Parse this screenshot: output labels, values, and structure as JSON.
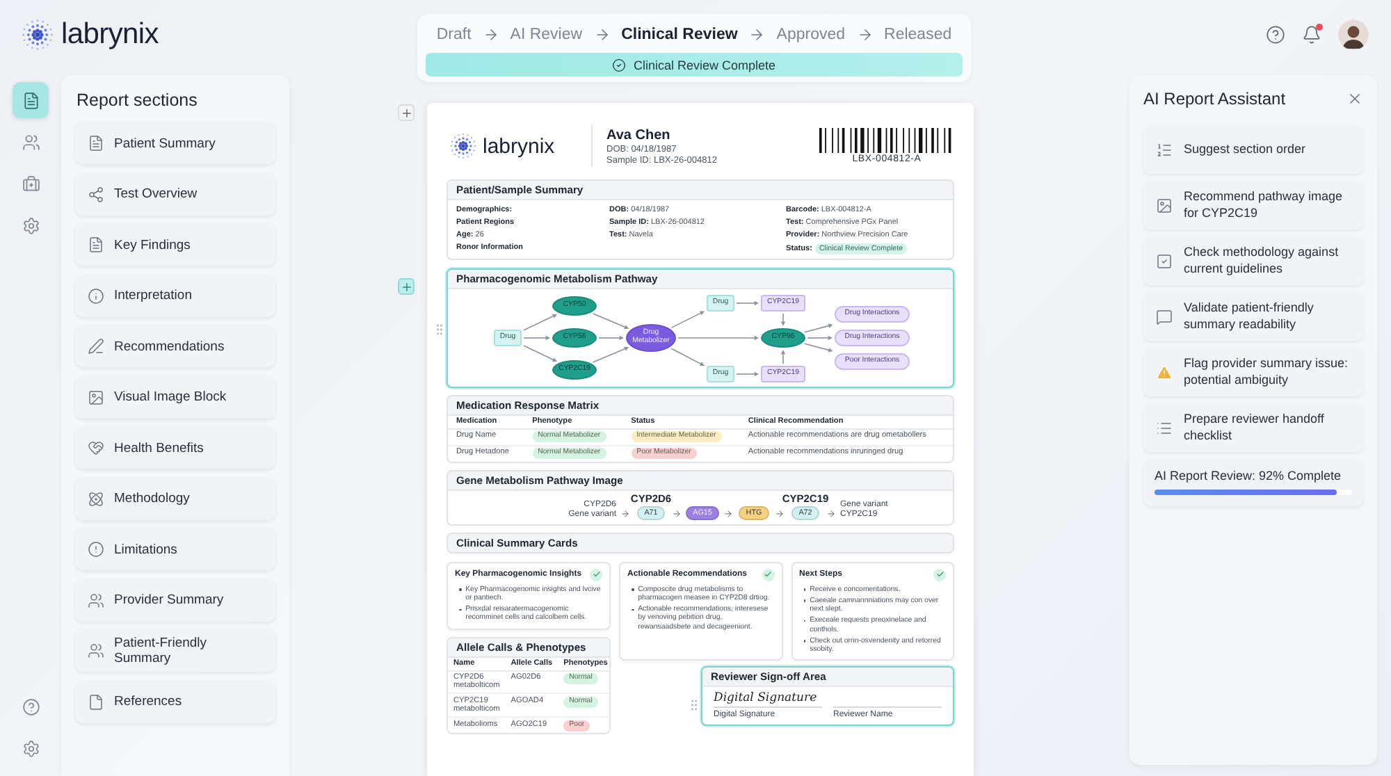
{
  "app": {
    "name": "labrynix"
  },
  "rail": [
    {
      "selected": true
    },
    {
      "selected": false
    },
    {
      "selected": false
    },
    {
      "selected": false
    }
  ],
  "workflow": {
    "steps": [
      {
        "label": "Draft",
        "selected": false
      },
      {
        "label": "AI Review",
        "selected": false
      },
      {
        "label": "Clinical Review",
        "selected": true
      },
      {
        "label": "Approved",
        "selected": false
      },
      {
        "label": "Released",
        "selected": false
      }
    ],
    "banner": "Clinical Review Complete"
  },
  "header": {
    "notifications_unread": true
  },
  "sections": {
    "title": "Report sections",
    "items": [
      "Patient Summary",
      "Test Overview",
      "Key Findings",
      "Interpretation",
      "Recommendations",
      "Visual Image Block",
      "Health Benefits",
      "Methodology",
      "Limitations",
      "Provider Summary",
      "Patient-Friendly Summary",
      "References"
    ]
  },
  "report": {
    "brand": "labrynix",
    "patient_name": "Ava Chen",
    "dob": "DOB: 04/18/1987",
    "sample_id": "Sample ID: LBX-26-004812",
    "barcode": "LBX-004812-A",
    "summary": {
      "title": "Patient/Sample Summary",
      "columns": [
        [
          {
            "label": "Demographics:"
          },
          {
            "label": "Patient Regions"
          },
          {
            "label": "Age:",
            "value": "26"
          },
          {
            "label": "Ronor Information"
          }
        ],
        [
          {
            "label": "DOB:",
            "value": "04/18/1987"
          },
          {
            "label": "Sample ID:",
            "value": "LBX-26-004812"
          },
          {
            "label": "Test:",
            "value": "Navela"
          }
        ],
        [
          {
            "label": "Barcode:",
            "value": "LBX-004812-A"
          },
          {
            "label": "Test:",
            "value": "Comprehensive PGx Panel"
          },
          {
            "label": "Provider:",
            "value": "Northview Precision Care"
          },
          {
            "label": "Status:",
            "badge": "Clinical Review Complete"
          }
        ]
      ]
    },
    "pathway": {
      "title": "Pharmacogenomic Metabolism Pathway",
      "selected": true,
      "nodes": [
        {
          "label": "Drug",
          "kind": "drug"
        },
        {
          "label": "CYP50",
          "kind": "enzyme"
        },
        {
          "label": "CYP56",
          "kind": "enzyme"
        },
        {
          "label": "CYP2C19",
          "kind": "enzyme"
        },
        {
          "label": "Drug Metabolizer",
          "kind": "metabolizer"
        },
        {
          "label": "Drug",
          "kind": "drug"
        },
        {
          "label": "CYP2C19",
          "kind": "target"
        },
        {
          "label": "CYP96",
          "kind": "enzyme"
        },
        {
          "label": "Drug",
          "kind": "drug"
        },
        {
          "label": "CYP2C19",
          "kind": "target"
        },
        {
          "label": "Drug Interactions",
          "kind": "outcome"
        },
        {
          "label": "Drug Interactions",
          "kind": "outcome"
        },
        {
          "label": "Poor Interactions",
          "kind": "outcome"
        }
      ]
    },
    "matrix": {
      "title": "Medication Response Matrix",
      "columns": [
        "Medication",
        "Phenotype",
        "Status",
        "Clinical Recommendation"
      ],
      "rows": [
        {
          "medication": "Drug Name",
          "phenotype": {
            "text": "Normal Metabolizer",
            "color": "#d4f3e1"
          },
          "status": {
            "text": "Intermediate Metabolizer",
            "color": "#fbecc2"
          },
          "recommendation": "Actionable recommendations are drug ometabollers"
        },
        {
          "medication": "Drug Hetadone",
          "phenotype": {
            "text": "Normal Metabolizer",
            "color": "#d4f3e1"
          },
          "status": {
            "text": "Poor Metabolizer",
            "color": "#f8d0d0"
          },
          "recommendation": "Actionable recommendations inruringed drug"
        }
      ]
    },
    "gene_image": {
      "title": "Gene Metabolism Pathway Image",
      "start": [
        "CYP2D6",
        "Gene variant"
      ],
      "steps": [
        {
          "label": "A71",
          "color": "#d3f1f1",
          "heading": "CYP2D6"
        },
        {
          "label": "AG15",
          "color": "#9d80e3"
        },
        {
          "label": "HTG",
          "color": "#f6d27e"
        },
        {
          "label": "A72",
          "color": "#d3f1f1",
          "heading": "CYP2C19"
        }
      ],
      "end": [
        "Gene variant",
        "CYP2C19"
      ]
    },
    "cards_title": "Clinical Summary Cards",
    "cards": [
      {
        "title": "Key Pharmacogenomic Insights",
        "checked": true,
        "bullets": [
          "Key Pharmacogenomic insights and lvcive or pantiech.",
          "Prisxdal reisaratermacogenomic recomminet cells and calcolbem cells."
        ]
      },
      {
        "title": "Actionable Recommendations",
        "checked": true,
        "bullets": [
          "Composcite drug metabolisms to pharmacogen measee in CYP2D8 drtiog.",
          "Actionable recommendations, interesese by venoving pebition drug, rewansaadsbete and decageeniont."
        ]
      },
      {
        "title": "Next Steps",
        "checked": true,
        "bullets": [
          "Receive e concomentations.",
          "Caeeale camnannniations may con over next slept.",
          "Execeale requests preoxinelace and conthols.",
          "Check out orrin-osvendenity and retorred ssobity."
        ]
      }
    ],
    "alleles": {
      "title": "Allele Calls & Phenotypes",
      "columns": [
        "Name",
        "Allele Calls",
        "Phenotypes"
      ],
      "rows": [
        {
          "name": "CYP2D6 metabolticom",
          "call": "AG02D6",
          "phenotype": {
            "text": "Normal",
            "color": "#d4f3e1"
          }
        },
        {
          "name": "CYP2C19 metabolticom",
          "call": "AGOAD4",
          "phenotype": {
            "text": "Normal",
            "color": "#d4f3e1"
          }
        },
        {
          "name": "Metabolioms",
          "call": "AGO2C19",
          "phenotype": {
            "text": "Poor",
            "color": "#f8d0d0"
          }
        }
      ]
    },
    "signoff": {
      "title": "Reviewer Sign-off Area",
      "selected": true,
      "signature": "Digital Signature",
      "fields": [
        "Digital Signature",
        "Reviewer Name"
      ]
    }
  },
  "assistant": {
    "title": "AI Report Assistant",
    "items": [
      {
        "label": "Suggest section order",
        "kind": "suggestion"
      },
      {
        "label": "Recommend pathway image for CYP2C19",
        "kind": "suggestion"
      },
      {
        "label": "Check methodology against current guidelines",
        "kind": "suggestion"
      },
      {
        "label": "Validate patient-friendly summary readability",
        "kind": "suggestion"
      },
      {
        "label": "Flag provider summary issue: potential ambiguity",
        "kind": "warning"
      },
      {
        "label": "Prepare reviewer handoff checklist",
        "kind": "suggestion"
      }
    ],
    "progress": {
      "label": "AI Report Review: 92% Complete",
      "level": 0.92
    }
  }
}
